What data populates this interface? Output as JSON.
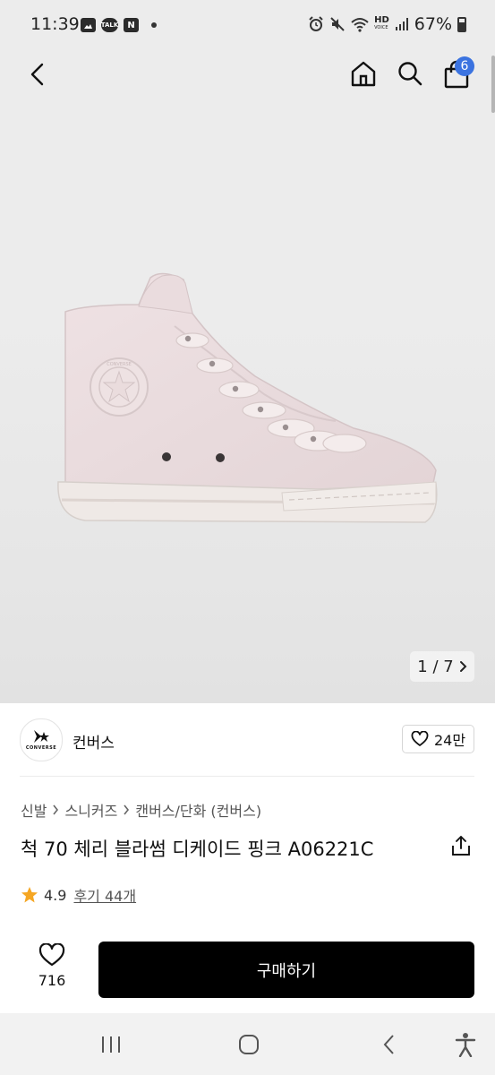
{
  "status": {
    "time": "11:39",
    "notif_icons": [
      "image-icon",
      "talk-icon",
      "n-icon"
    ],
    "talk_label": "TALK",
    "n_label": "N",
    "hd_label": "HD",
    "voice_label": "VOICE",
    "battery": "67%"
  },
  "hero": {
    "pager_text": "1 / 7",
    "cart_count": "6",
    "shoe_brand_text": "CONVERSE"
  },
  "brand": {
    "name": "컨버스",
    "logo_text": "CONVERSE",
    "likes": "24만"
  },
  "breadcrumb": [
    "신발",
    "스니커즈",
    "캔버스/단화 (컨버스)"
  ],
  "product": {
    "title": "척 70 체리 블라썸 디케이드 핑크 A06221C",
    "rating": "4.9",
    "reviews": "후기 44개"
  },
  "purchase": {
    "wish_count": "716",
    "buy_label": "구매하기"
  },
  "colors": {
    "buy_button": "#000000",
    "cart_badge": "#3b73e0",
    "star": "#f5a623"
  }
}
